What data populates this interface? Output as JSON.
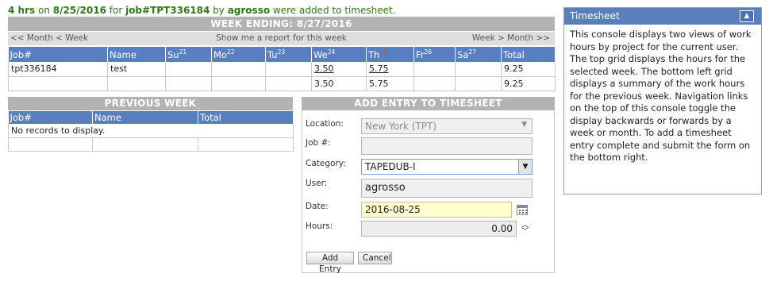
{
  "status": {
    "hours": "4 hrs",
    "on_text": " on ",
    "date": "8/25/2016",
    "for_text": " for ",
    "job": "job#TPT336184",
    "by_text": " by ",
    "user": "agrosso",
    "tail_text": " were added to timesheet."
  },
  "week": {
    "header": "WEEK ENDING: 8/27/2016",
    "nav_prev": "<< Month < Week",
    "nav_report": "Show me a report for this week",
    "nav_next": "Week > Month >>"
  },
  "main_grid": {
    "columns": [
      {
        "label": "Job#",
        "sup": ""
      },
      {
        "label": "Name",
        "sup": ""
      },
      {
        "label": "Su",
        "sup": "21"
      },
      {
        "label": "Mo",
        "sup": "22"
      },
      {
        "label": "Tu",
        "sup": "23"
      },
      {
        "label": "We",
        "sup": "24"
      },
      {
        "label": "Th",
        "sup": "25"
      },
      {
        "label": "Fr",
        "sup": "26"
      },
      {
        "label": "Sa",
        "sup": "27"
      },
      {
        "label": "Total",
        "sup": ""
      }
    ],
    "rows": [
      [
        "tpt336184",
        "test",
        "",
        "",
        "",
        "3.50",
        "5.75",
        "",
        "",
        "9.25"
      ]
    ],
    "totals": [
      "",
      "",
      "",
      "",
      "",
      "3.50",
      "5.75",
      "",
      "",
      "9.25"
    ]
  },
  "previous_week": {
    "header": "PREVIOUS WEEK",
    "columns": [
      "Job#",
      "Name",
      "Total"
    ],
    "empty_text": "No records to display."
  },
  "add_entry": {
    "header": "ADD ENTRY TO TIMESHEET",
    "location_label": "Location:",
    "location_value": "New York (TPT)",
    "job_label": "Job #:",
    "job_value": "",
    "category_label": "Category:",
    "category_value": "TAPEDUB-I",
    "user_label": "User:",
    "user_value": "agrosso",
    "date_label": "Date:",
    "date_value": "2016-08-25",
    "hours_label": "Hours:",
    "hours_value": "0.00",
    "add_button": "Add Entry",
    "cancel_button": "Cancel"
  },
  "panel": {
    "title": "Timesheet",
    "text": "This console displays two views of work hours by project for the current user. The top grid displays the hours for the selected week. The bottom left grid displays a summary of the work hours for the previous week. Navigation links on the top of this console toggle the display backwards or forwards by a week or month. To add a timesheet entry complete and submit the form on the bottom right."
  },
  "colors": {
    "header_blue": "#5a7fbf",
    "status_green": "#2c7a15",
    "bar_gray": "#b3b3b3",
    "today_marker_red": "#ff3030",
    "date_field_yellow": "#ffffd0"
  },
  "icons": {
    "location_dropdown": "triangle-down-icon",
    "category_dropdown": "chevron-down-icon",
    "date_picker": "calendar-icon",
    "hours_spinner": "spinner-arrows-icon",
    "panel_collapse": "chevron-up-icon"
  }
}
